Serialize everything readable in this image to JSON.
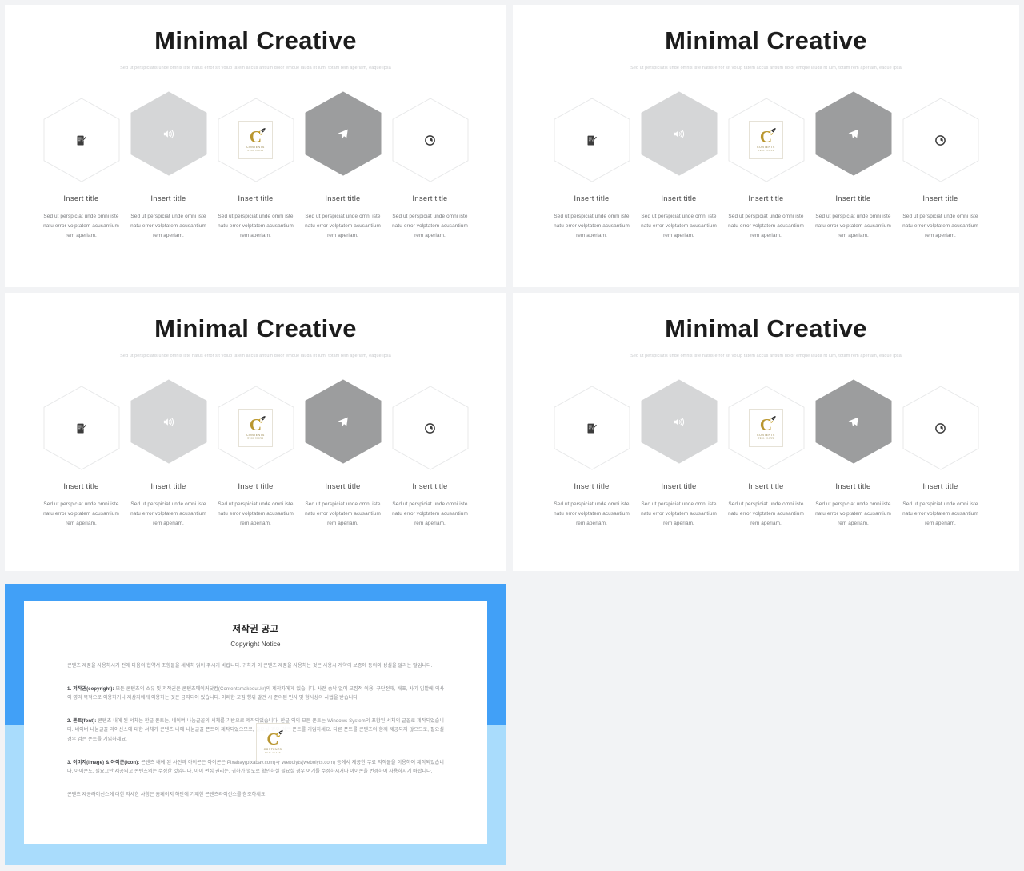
{
  "slide": {
    "title": "Minimal Creative",
    "subtitle": "Sed ut perspiciatis unde omnis iste natus error sit volup tatem accus antium dolor emque lauda nt ium, totam rem aperiam, eaque ipsa",
    "items": [
      {
        "icon": "note-pen-icon",
        "title": "Insert title",
        "body": "Sed ut perspiciat unde omni iste natu error volptatem acusantium rem aperiam.",
        "fill": "#ffffff",
        "stroke": "#e8e9ea",
        "icon_color": "#3c3c3c"
      },
      {
        "icon": "speaker-volume-icon",
        "title": "Insert title",
        "body": "Sed ut perspiciat unde omni iste natu error volptatem acusantium rem aperiam.",
        "fill": "#d5d6d7",
        "stroke": "#d5d6d7",
        "icon_color": "#ffffff"
      },
      {
        "icon": "watermark-logo-icon",
        "title": "Insert title",
        "body": "Sed ut perspiciat unde omni iste natu error volptatem acusantium rem aperiam.",
        "fill": "#ffffff",
        "stroke": "#e8e9ea",
        "icon_color": "#b9962f"
      },
      {
        "icon": "paper-plane-send-icon",
        "title": "Insert title",
        "body": "Sed ut perspiciat unde omni iste natu error volptatem acusantium rem aperiam.",
        "fill": "#9c9d9e",
        "stroke": "#9c9d9e",
        "icon_color": "#ffffff"
      },
      {
        "icon": "clock-circle-icon",
        "title": "Insert title",
        "body": "Sed ut perspiciat unde omni iste natu error volptatem acusantium rem aperiam.",
        "fill": "#ffffff",
        "stroke": "#e8e9ea",
        "icon_color": "#3c3c3c"
      }
    ]
  },
  "watermark": {
    "letter": "C",
    "line1": "CONTENTS",
    "line2": "REAL CLASS"
  },
  "copyright": {
    "heading_ko": "저작권 공고",
    "heading_en": "Copyright Notice",
    "intro": "콘텐츠 제품을 사용하시기 전에 다음의 협약서 조항들을 세세히 읽어 주시기 바랍니다. 귀하가 이 콘텐츠 제품을 사용하는 것은 사용시 계약의 보증에 동의와 성실을 알리는 말입니다.",
    "section1_label": "1. 저작권(copyright):",
    "section1": " 모든 콘텐츠의 소유 및 저작권은 콘텐츠메이커닷컴(Contentsmakeout.kr)의 제작자에게 있습니다. 사전 승낙 없이 교집적 이용, 구단전재, 배포, 사기 임발에 의사이 영리 목적으로 이용하거나 제삼자에게 이용하는 것은 금지되어 있습니다. 이러한 교집 행위 발견 시 준의된 민사 및 형사상의 사법을 받습니다.",
    "section2_label": "2. 폰트(font):",
    "section2": " 콘텐츠 내에 된 서체는 한글 폰트는, 네이버 나눔글꼴의 서체를 기반으로 제작되었습니다. 한글 외의 모든 폰트는 Windows System의 포함된 서체의 글꼴로 제작되었습니다. 네이버 나눔글꼴 라이선스에 대한 서체가 콘텐츠 내에 나눔글꼴 폰트이 제작되었으므로, 필요실 경우 검은 폰트를 기입하세요. 다른 폰트를 콘텐츠의 함께 제공되지 않으므로, 필요실 경우 검은 폰트를 기입하세요.",
    "section3_label": "3. 이미지(image) & 아이콘(icon):",
    "section3": " 콘텐츠 내에 된 사진과 아이콘은 아이콘은 Pixabay(pixabay.com)과 Webolyts(webolyts.com) 등에서 제공한 무료 저작물을 이용하여 제작되었습니다. 아이콘도, 필요그만 제공되고 콘텐츠의는 수정한 것입니다. 아이 편집 권리는, 귀하가 별도로 확인하실 필요실 경우 여기를 수정하시거나 아이콘을 변경하여 사용하시기 바랍니다.",
    "footer": "콘텐츠 제공라이선스에 대한 자세한 사항은 홈페이지 하단에 기재한 콘텐츠라이선스를 참조하세요."
  }
}
